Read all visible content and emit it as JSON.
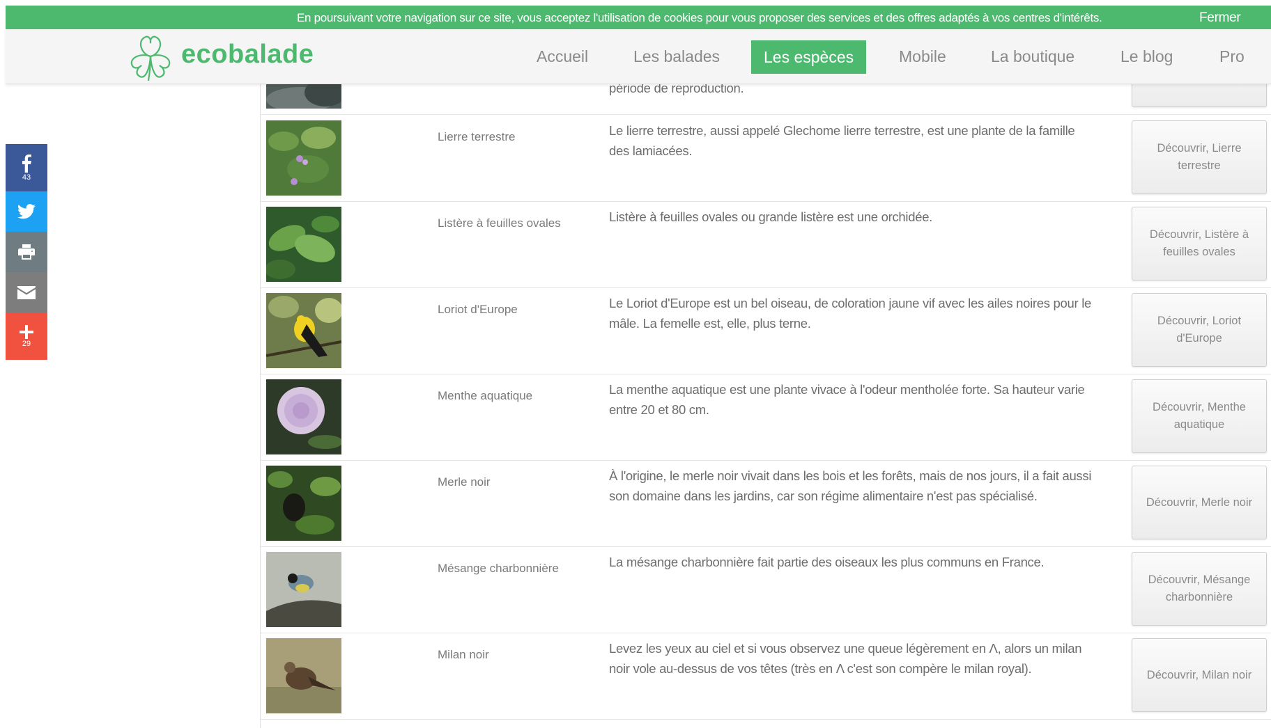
{
  "cookie_banner": {
    "text": "En poursuivant votre navigation sur ce site, vous acceptez l'utilisation de cookies pour vous proposer des services et des offres adaptés à vos centres d'intérêts.",
    "close_label": "Fermer"
  },
  "header": {
    "logo_text": "ecobalade",
    "nav": [
      {
        "label": "Accueil"
      },
      {
        "label": "Les balades"
      },
      {
        "label": "Les espèces",
        "active": true
      },
      {
        "label": "Mobile"
      },
      {
        "label": "La boutique"
      },
      {
        "label": "Le blog"
      },
      {
        "label": "Pro"
      }
    ]
  },
  "share": {
    "facebook_count": "43",
    "more_count": "29"
  },
  "partial_row": {
    "desc": "période de reproduction."
  },
  "species": [
    {
      "name": "Lierre terrestre",
      "desc": "Le lierre terrestre, aussi appelé Glechome lierre terrestre, est une plante de la famille des lamiacées.",
      "button": "Découvrir, Lierre terrestre"
    },
    {
      "name": "Listère à feuilles ovales",
      "desc": "Listère à feuilles ovales ou grande listère est une orchidée.",
      "button": "Découvrir, Listère à feuilles ovales"
    },
    {
      "name": "Loriot d'Europe",
      "desc": "Le Loriot d'Europe est un bel oiseau, de coloration jaune vif avec les ailes noires pour le mâle. La femelle est, elle, plus terne.",
      "button": "Découvrir, Loriot d'Europe"
    },
    {
      "name": "Menthe aquatique",
      "desc": "La menthe aquatique est une plante vivace à l'odeur mentholée forte. Sa hauteur varie entre 20 et 80 cm.",
      "button": "Découvrir, Menthe aquatique"
    },
    {
      "name": "Merle noir",
      "desc": "À l'origine, le merle noir vivait dans les bois et les forêts, mais de nos jours, il a fait aussi son domaine dans les jardins, car son régime alimentaire n'est pas spécialisé.",
      "button": "Découvrir, Merle noir"
    },
    {
      "name": "Mésange charbonnière",
      "desc": "La mésange charbonnière fait partie des oiseaux les plus communs en France.",
      "button": "Découvrir, Mésange charbonnière"
    },
    {
      "name": "Milan noir",
      "desc": "Levez les yeux au ciel et si vous observez une queue légèrement en Λ, alors un milan noir vole au-dessus de vos têtes (très en Λ c'est son compère le milan royal).",
      "button": "Découvrir, Milan noir"
    }
  ],
  "colors": {
    "brand_green": "#4cb96f",
    "facebook": "#3b5998",
    "twitter": "#1da1f2",
    "print": "#6f7c82",
    "email": "#7d7d7d",
    "more": "#f0523f"
  }
}
